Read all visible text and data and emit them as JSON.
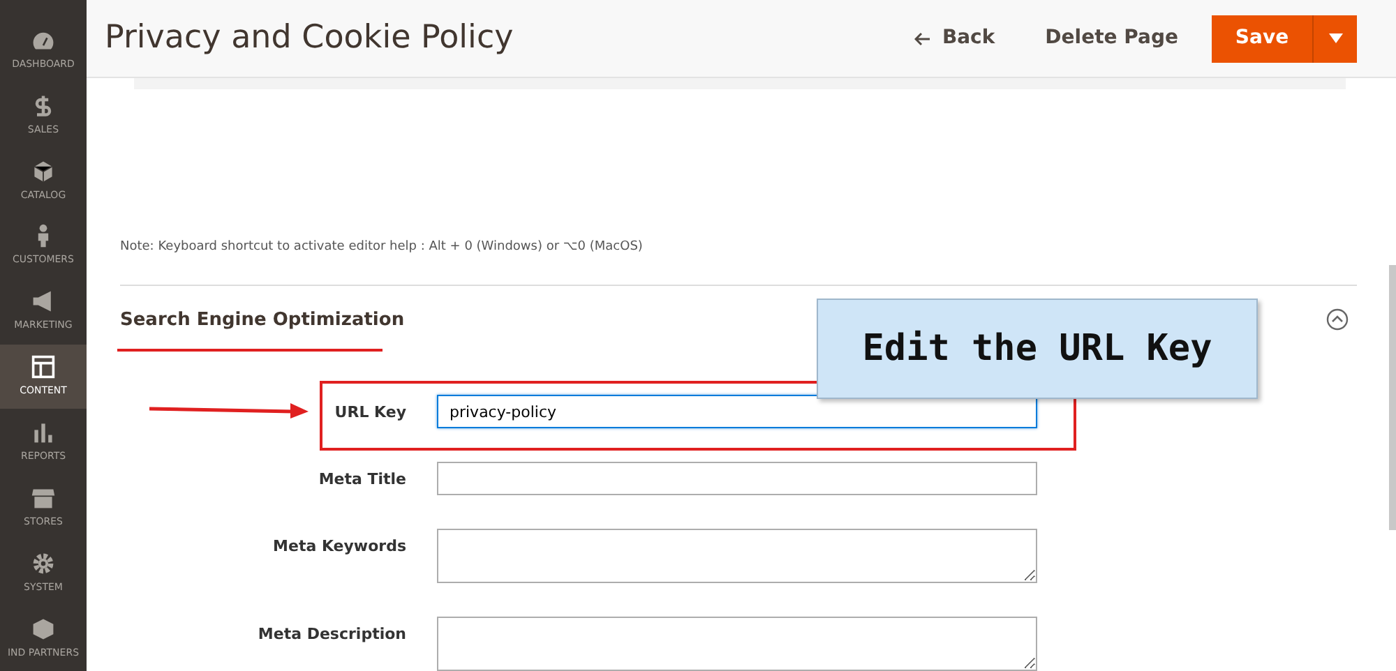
{
  "sidebar": {
    "items": [
      {
        "label": "DASHBOARD",
        "selected": false
      },
      {
        "label": "SALES",
        "selected": false
      },
      {
        "label": "CATALOG",
        "selected": false
      },
      {
        "label": "CUSTOMERS",
        "selected": false
      },
      {
        "label": "MARKETING",
        "selected": false
      },
      {
        "label": "CONTENT",
        "selected": true
      },
      {
        "label": "REPORTS",
        "selected": false
      },
      {
        "label": "STORES",
        "selected": false
      },
      {
        "label": "SYSTEM",
        "selected": false
      },
      {
        "label": "IND PARTNERS",
        "selected": false
      }
    ]
  },
  "header": {
    "title": "Privacy and Cookie Policy",
    "back": "Back",
    "delete": "Delete Page",
    "save": "Save"
  },
  "editor_note": "Note: Keyboard shortcut to activate editor help : Alt + 0 (Windows) or ⌥0 (MacOS)",
  "section": {
    "title": "Search Engine Optimization",
    "expanded": true,
    "fields": [
      {
        "label": "URL Key",
        "kind": "input",
        "value": "privacy-policy",
        "focused": true
      },
      {
        "label": "Meta Title",
        "kind": "input",
        "focused": false
      },
      {
        "label": "Meta Keywords",
        "kind": "textarea",
        "focused": false
      },
      {
        "label": "Meta Description",
        "kind": "textarea",
        "focused": false
      }
    ]
  },
  "callout": {
    "text": "Edit the URL Key"
  }
}
